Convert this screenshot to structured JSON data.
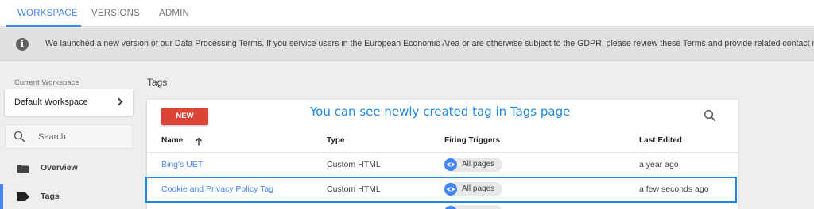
{
  "tabs": [
    {
      "label": "WORKSPACE",
      "active": true
    },
    {
      "label": "VERSIONS",
      "active": false
    },
    {
      "label": "ADMIN",
      "active": false
    }
  ],
  "banner": {
    "icon": "info-icon",
    "text": "We launched a new version of our Data Processing Terms. If you service users in the European Economic Area or are otherwise subject to the GDPR, please review these Terms and provide related contact information"
  },
  "sidebar": {
    "workspace_label": "Current Workspace",
    "workspace_name": "Default Workspace",
    "search_placeholder": "Search",
    "items": [
      {
        "label": "Overview",
        "icon": "folder-icon",
        "active": false
      },
      {
        "label": "Tags",
        "icon": "tag-icon",
        "active": true
      }
    ]
  },
  "main": {
    "title": "Tags",
    "new_button": "NEW",
    "annotation": "You can see newly created tag in Tags page",
    "columns": [
      "Name",
      "Type",
      "Firing Triggers",
      "Last Edited"
    ],
    "sort": "ascending",
    "rows": [
      {
        "name": "Bing's UET",
        "type": "Custom HTML",
        "trigger": "All pages",
        "last_edited": "a year ago",
        "highlighted": false
      },
      {
        "name": "Cookie and Privacy Policy Tag",
        "type": "Custom HTML",
        "trigger": "All pages",
        "last_edited": "a few seconds ago",
        "highlighted": true
      }
    ]
  },
  "colors": {
    "accent": "#4285f4",
    "new_button": "#db4437",
    "annotation": "#1e88e5"
  }
}
